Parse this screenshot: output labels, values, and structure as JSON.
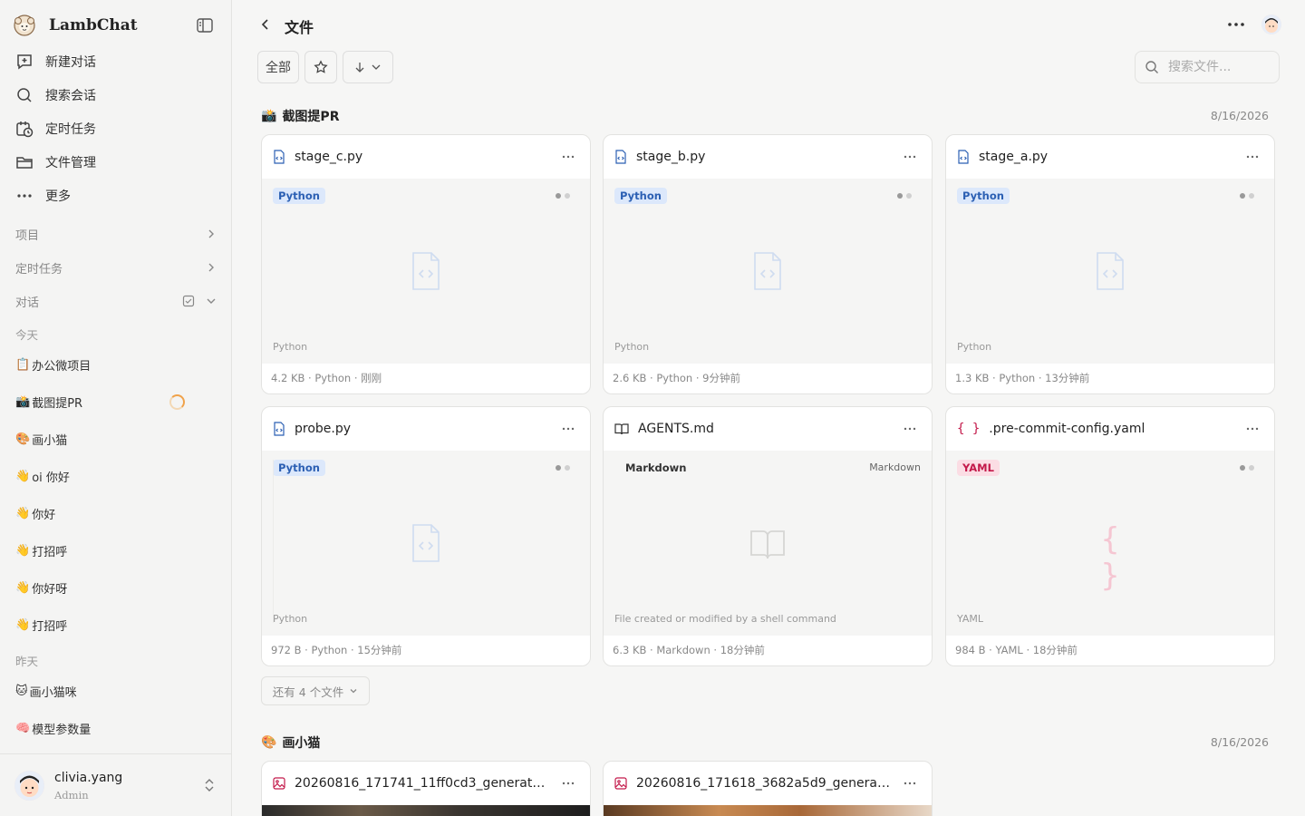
{
  "app": {
    "name": "LambChat"
  },
  "nav": [
    {
      "label": "新建对话",
      "icon": "new-chat-icon"
    },
    {
      "label": "搜索会话",
      "icon": "search-icon"
    },
    {
      "label": "定时任务",
      "icon": "calendar-clock-icon"
    },
    {
      "label": "文件管理",
      "icon": "folder-icon"
    },
    {
      "label": "更多",
      "icon": "more-icon"
    }
  ],
  "sections": {
    "projects": "项目",
    "scheduled": "定时任务",
    "chats": "对话"
  },
  "chat_groups": {
    "today_label": "今天",
    "today": [
      {
        "emoji": "📋",
        "title": "办公微项目"
      },
      {
        "emoji": "📸",
        "title": "截图提PR"
      },
      {
        "emoji": "🎨",
        "title": "画小猫"
      },
      {
        "emoji": "👋",
        "title": "oi 你好"
      },
      {
        "emoji": "👋",
        "title": " 你好"
      },
      {
        "emoji": "👋",
        "title": " 打招呼"
      },
      {
        "emoji": "👋",
        "title": "你好呀"
      },
      {
        "emoji": "👋",
        "title": " 打招呼"
      }
    ],
    "yesterday_label": "昨天",
    "yesterday": [
      {
        "emoji": "🐱",
        "title": " 画小猫咪"
      },
      {
        "emoji": "🧠",
        "title": " 模型参数量"
      }
    ]
  },
  "user": {
    "name": "clivia.yang",
    "role": "Admin"
  },
  "main": {
    "title": "文件",
    "filter_all": "全部",
    "search_placeholder": "搜索文件..."
  },
  "groups": [
    {
      "emoji": "📸",
      "name": "截图提PR",
      "date": "8/16/2026",
      "files": [
        {
          "name": "stage_c.py",
          "badge": "Python",
          "bottom_lang": "Python",
          "meta": "4.2 KB · Python · 刚刚"
        },
        {
          "name": "stage_b.py",
          "badge": "Python",
          "bottom_lang": "Python",
          "meta": "2.6 KB · Python · 9分钟前"
        },
        {
          "name": "stage_a.py",
          "badge": "Python",
          "bottom_lang": "Python",
          "meta": "1.3 KB · Python · 13分钟前"
        },
        {
          "name": "probe.py",
          "badge": "Python",
          "bottom_lang": "Python",
          "meta": "972 B · Python · 15分钟前"
        },
        {
          "name": "AGENTS.md",
          "badge": "Markdown",
          "right_lang": "Markdown",
          "bottom_lang": "File created or modified by a shell command",
          "meta": "6.3 KB · Markdown · 18分钟前"
        },
        {
          "name": ".pre-commit-config.yaml",
          "badge": "YAML",
          "bottom_lang": "YAML",
          "meta": "984 B · YAML · 18分钟前"
        }
      ],
      "more_label": "还有 4 个文件"
    },
    {
      "emoji": "🎨",
      "name": "画小猫",
      "date": "8/16/2026",
      "files": [
        {
          "name": "20260816_171741_11ff0cd3_generated-..."
        },
        {
          "name": "20260816_171618_3682a5d9_generated..."
        }
      ]
    }
  ],
  "colors": {
    "accent": "#2b5fb3",
    "yaml": "#c3194a",
    "spinner": "#f0a24a"
  }
}
